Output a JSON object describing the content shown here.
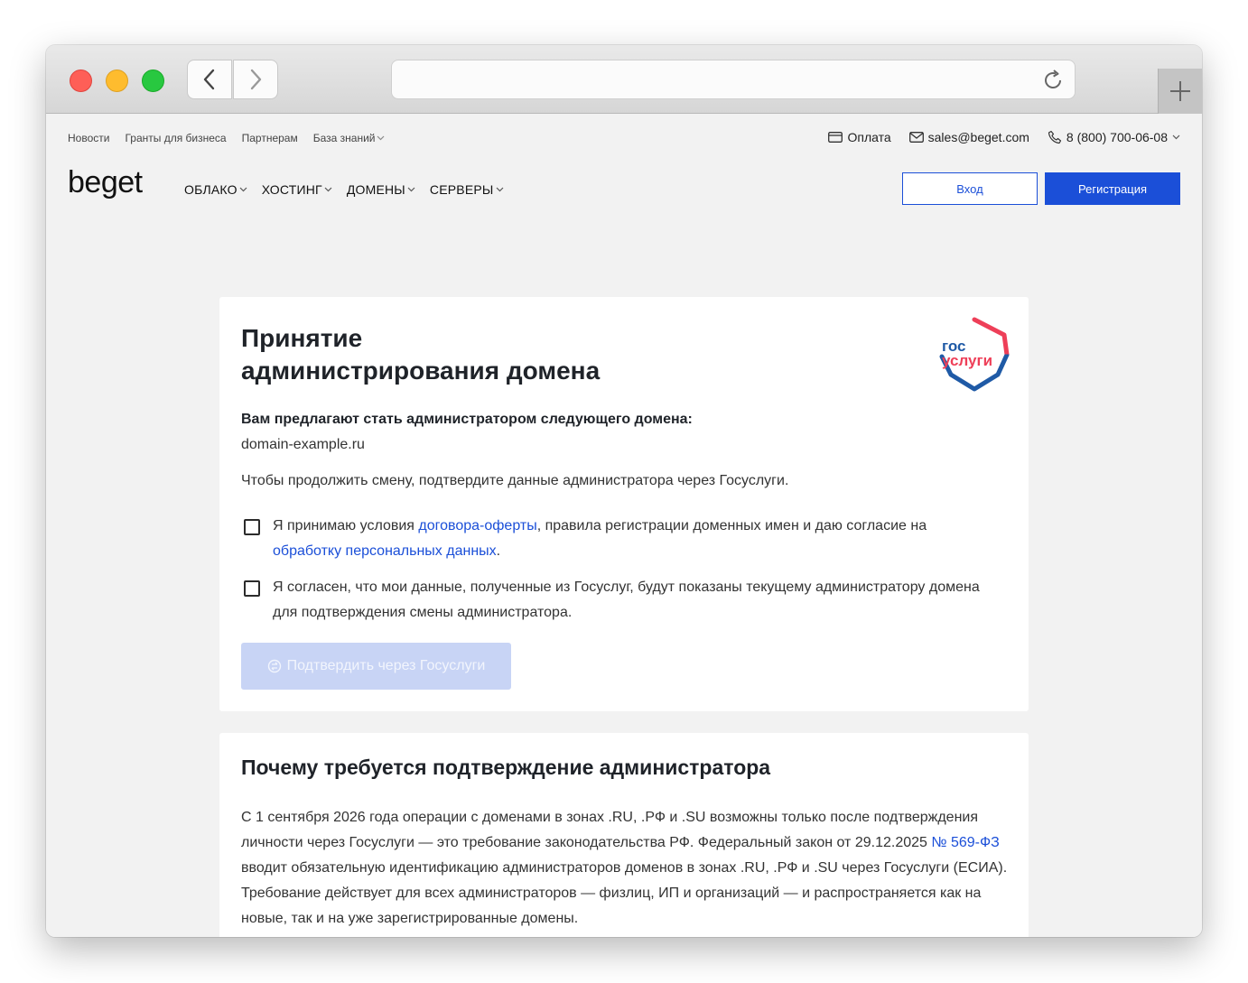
{
  "topnav": {
    "items": [
      "Новости",
      "Гранты для бизнеса",
      "Партнерам",
      "База знаний"
    ],
    "payment": "Оплата",
    "email": "sales@beget.com",
    "phone": "8 (800) 700-06-08"
  },
  "header": {
    "logo": "beget",
    "menu": [
      "ОБЛАКО",
      "ХОСТИНГ",
      "ДОМЕНЫ",
      "СЕРВЕРЫ"
    ],
    "login": "Вход",
    "register": "Регистрация"
  },
  "card1": {
    "title_line1": "Принятие",
    "title_line2": "администрирования домена",
    "gos_logo_line1": "гос",
    "gos_logo_line2": "услуги",
    "lead": "Вам предлагают стать администратором следующего домена:",
    "domain": "domain-example.ru",
    "hint": "Чтобы продолжить смену, подтвердите данные администратора через Госуслуги.",
    "check1": {
      "pre": "Я принимаю условия ",
      "link1": "договора-оферты",
      "mid": ", правила регистрации доменных имен и даю согласие на ",
      "link2": "обработку персональных данных",
      "post": "."
    },
    "check2": "Я согласен, что мои данные, полученные из Госуслуг, будут показаны текущему администратору домена для подтверждения смены администратора.",
    "confirm": "Подтвердить через Госуслуги"
  },
  "card2": {
    "title": "Почему требуется подтверждение администратора",
    "p_pre": "С 1 сентября 2026 года операции с доменами в зонах .RU, .РФ и .SU возможны только после подтверждения личности через Госуслуги — это требование законодательства РФ. Федеральный закон от 29.12.2025 ",
    "p_link": "№ 569-ФЗ",
    "p_post": " вводит обязательную идентификацию администраторов доменов в зонах .RU, .РФ и .SU через Госуслуги (ЕСИА). Требование действует для всех администраторов — физлиц, ИП и организаций — и распространяется как на новые, так и на уже зарегистрированные домены."
  },
  "colors": {
    "accent": "#1b4fd8",
    "disabled_button": "#c8d4f5"
  }
}
